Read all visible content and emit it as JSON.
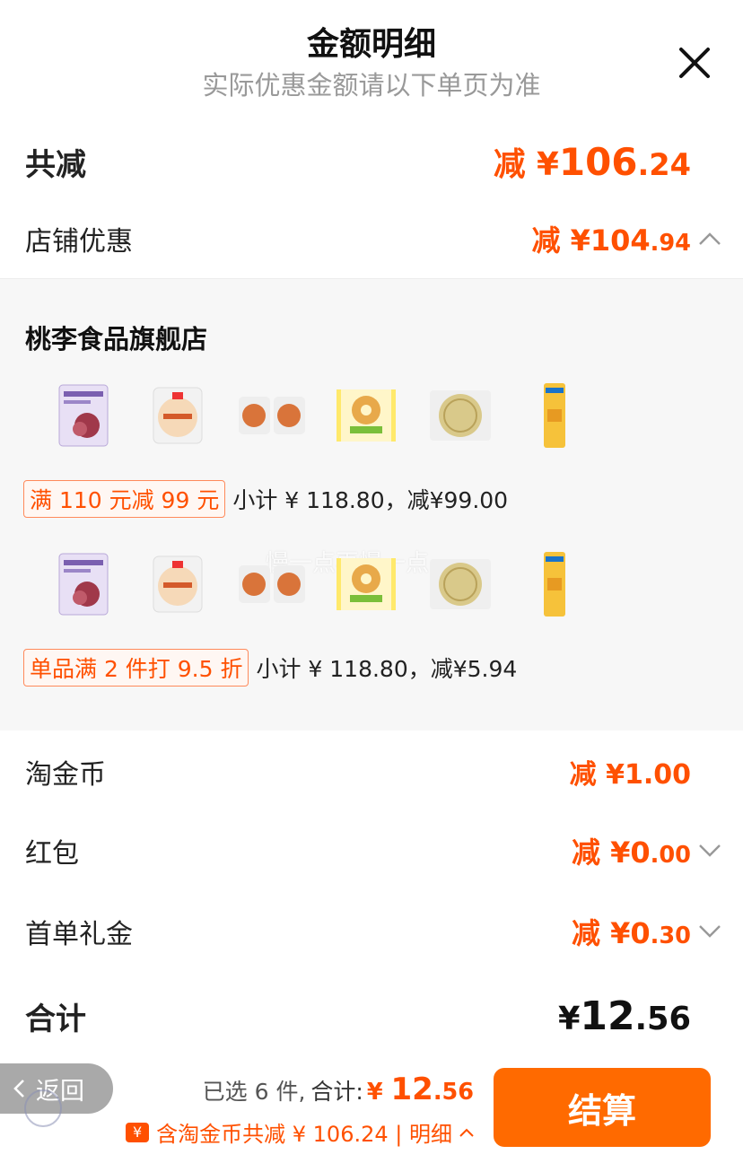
{
  "header": {
    "title": "金额明细",
    "subtitle": "实际优惠金额请以下单页为准"
  },
  "total_discount": {
    "label": "共减",
    "prefix": "减 ¥",
    "int": "106",
    "dec": ".24"
  },
  "shop_discount": {
    "label": "店铺优惠",
    "prefix": "减 ¥",
    "int": "104",
    "dec": ".94"
  },
  "shop": {
    "name": "桃李食品旗舰店",
    "watermark": "慢一点再慢一点",
    "promos": [
      {
        "tag": "满 110 元减 99 元",
        "text": "小计 ¥ 118.80，减¥99.00"
      },
      {
        "tag": "单品满 2 件打 9.5 折",
        "text": "小计 ¥ 118.80，减¥5.94"
      }
    ]
  },
  "tao_coin": {
    "label": "淘金币",
    "prefix": "减 ¥",
    "int": "1",
    "dec": ".00"
  },
  "red_packet": {
    "label": "红包",
    "prefix": "减 ¥",
    "int": "0",
    "dec": ".00"
  },
  "first_order": {
    "label": "首单礼金",
    "prefix": "减 ¥",
    "int": "0",
    "dec": ".30"
  },
  "sum": {
    "label": "合计",
    "prefix": "¥",
    "int": "12",
    "dec": ".56"
  },
  "bottom": {
    "back_label": "返回",
    "selected": "已选 6 件,",
    "total_label": "合计:",
    "price_prefix": "¥ ",
    "price_int": "12",
    "price_dec": ".56",
    "coin_glyph": "¥",
    "save_text": "含淘金币共减 ¥ 106.24 | 明细",
    "checkout": "结算"
  },
  "colors": {
    "accent": "#ff5000",
    "checkout": "#ff6a00",
    "panel": "#f7f7f7"
  }
}
